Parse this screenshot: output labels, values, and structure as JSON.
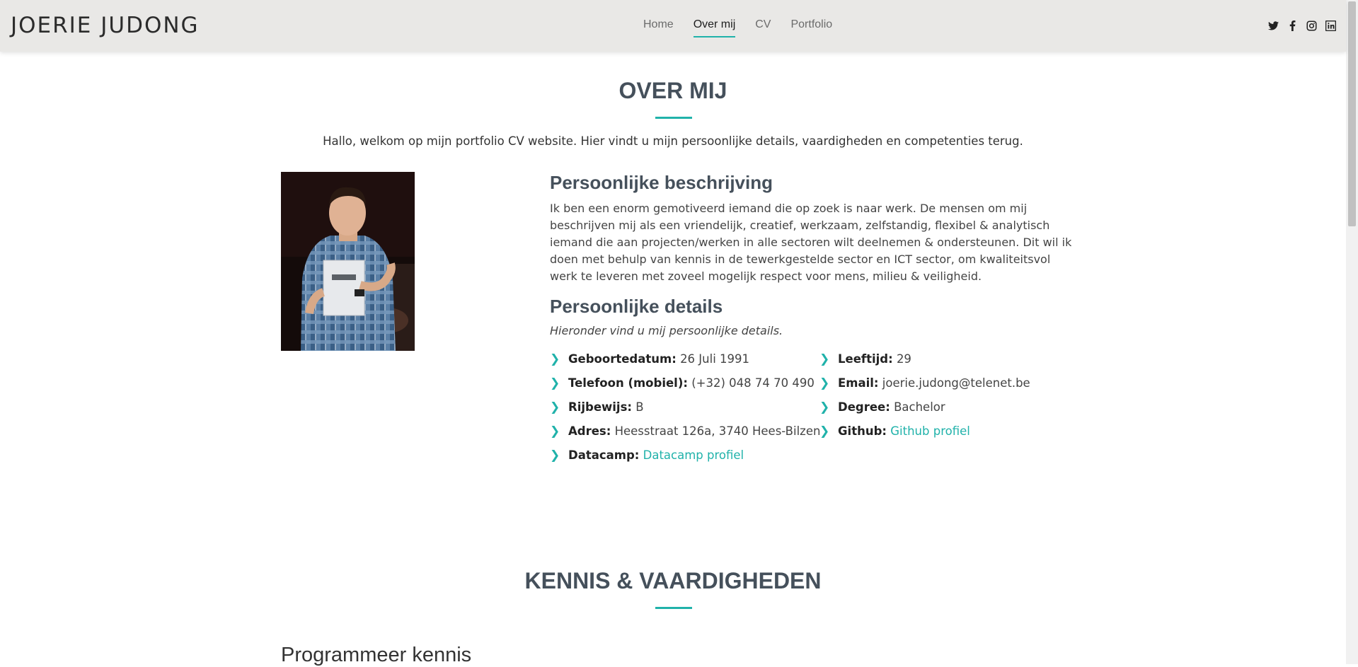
{
  "brand": "JOERIE JUDONG",
  "nav": {
    "items": [
      {
        "label": "Home",
        "active": false
      },
      {
        "label": "Over mij",
        "active": true
      },
      {
        "label": "CV",
        "active": false
      },
      {
        "label": "Portfolio",
        "active": false
      }
    ]
  },
  "social": [
    "twitter-icon",
    "facebook-icon",
    "instagram-icon",
    "linkedin-icon"
  ],
  "about": {
    "title": "OVER MIJ",
    "intro": "Hallo, welkom op mijn portfolio CV website. Hier vindt u mijn persoonlijke details, vaardigheden en competenties terug.",
    "description_title": "Persoonlijke beschrijving",
    "description": "Ik ben een enorm gemotiveerd iemand die op zoek is naar werk. De mensen om mij beschrijven mij als een vriendelijk, creatief, werkzaam, zelfstandig, flexibel & analytisch iemand die aan projecten/werken in alle sectoren wilt deelnemen & ondersteunen. Dit wil ik doen met behulp van kennis in de tewerkgestelde sector en ICT sector, om kwaliteitsvol werk te leveren met zoveel mogelijk respect voor mens, milieu & veiligheid.",
    "details_title": "Persoonlijke details",
    "details_subtitle": "Hieronder vind u mij persoonlijke details.",
    "details_left": [
      {
        "label": "Geboortedatum:",
        "value": "26 Juli 1991"
      },
      {
        "label": "Telefoon (mobiel):",
        "value": "(+32) 048 74 70 490"
      },
      {
        "label": "Rijbewijs:",
        "value": "B"
      },
      {
        "label": "Adres:",
        "value": "Heesstraat 126a, 3740 Hees-Bilzen"
      },
      {
        "label": "Datacamp:",
        "value": "Datacamp profiel",
        "link": true
      }
    ],
    "details_right": [
      {
        "label": "Leeftijd:",
        "value": "29"
      },
      {
        "label": "Email:",
        "value": "joerie.judong@telenet.be"
      },
      {
        "label": "Degree:",
        "value": "Bachelor"
      },
      {
        "label": "Github:",
        "value": "Github profiel",
        "link": true
      }
    ]
  },
  "skills": {
    "title": "KENNIS & VAARDIGHEDEN",
    "subtitle": "Programmeer kennis"
  },
  "colors": {
    "accent": "#20b2aa",
    "header_bg": "#e9e8e6",
    "heading": "#45505b"
  }
}
